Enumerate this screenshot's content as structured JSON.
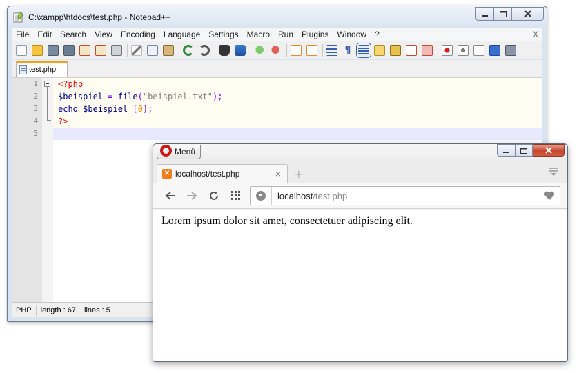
{
  "notepad": {
    "title": "C:\\xampp\\htdocs\\test.php - Notepad++",
    "menu": [
      "File",
      "Edit",
      "Search",
      "View",
      "Encoding",
      "Language",
      "Settings",
      "Macro",
      "Run",
      "Plugins",
      "Window",
      "?"
    ],
    "menu_close": "X",
    "tab_label": "test.php",
    "toolbar_icons": [
      "new-file-icon",
      "open-file-icon",
      "save-icon",
      "save-all-icon",
      "close-icon",
      "close-all-icon",
      "print-icon",
      "cut-icon",
      "copy-icon",
      "paste-icon",
      "undo-icon",
      "redo-icon",
      "find-icon",
      "replace-icon",
      "zoom-in-icon",
      "zoom-out-icon",
      "sync-vertical-icon",
      "sync-horizontal-icon",
      "word-wrap-icon",
      "show-all-chars-icon",
      "indent-guide-icon",
      "document-map-icon",
      "function-list-icon",
      "folder-as-workspace-icon",
      "monitoring-icon",
      "record-macro-icon",
      "stop-recording-icon",
      "play-macro-icon",
      "run-macro-multiple-icon",
      "save-macro-icon"
    ],
    "line_numbers": [
      "1",
      "2",
      "3",
      "4",
      "5"
    ],
    "code": {
      "l1_php_open": "<?php",
      "l2_var": "$beispiel",
      "l2_eq": " = ",
      "l2_fn": "file",
      "l2_paren_open": "(",
      "l2_str": "\"beispiel.txt\"",
      "l2_end": ");",
      "l3_kw": "echo ",
      "l3_var": "$beispiel",
      "l3_bracket_open": " [",
      "l3_num": "0",
      "l3_end": "];",
      "l4_php_close": "?>"
    },
    "status": {
      "language": "PHP",
      "length": "length : 67",
      "lines": "lines : 5"
    }
  },
  "browser": {
    "menu_label": "Menü",
    "tab_title": "localhost/test.php",
    "tab_close": "×",
    "new_tab": "+",
    "address_host": "localhost",
    "address_path": "/test.php",
    "page_text": "Lorem ipsum dolor sit amet, consectetuer adipiscing elit."
  },
  "colors": {
    "php_delimiter": "#ff0000",
    "variable": "#000080",
    "operator": "#8000ff",
    "string": "#808080",
    "number": "#ff8000",
    "tab_accent": "#f79e1b",
    "opera_red": "#cc1a1a"
  }
}
